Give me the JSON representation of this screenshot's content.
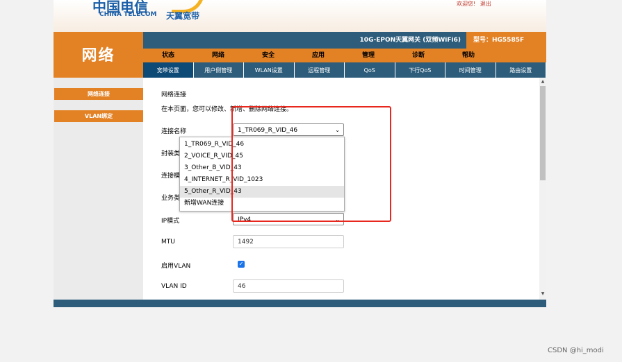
{
  "header": {
    "brand_cn": "中国电信",
    "brand_en": "CHINA TELECOM",
    "sub_brand": "天翼宽带",
    "welcome": "欢迎您!",
    "logout": "退出"
  },
  "section_title": "网络",
  "device": {
    "name": "10G-EPON天翼网关 (双频WiFi6)",
    "model": "型号：HG5585F"
  },
  "main_menu": [
    "状态",
    "网络",
    "安全",
    "应用",
    "管理",
    "诊断",
    "帮助"
  ],
  "sub_menu": [
    "宽带设置",
    "用户侧管理",
    "WLAN设置",
    "远程管理",
    "QoS",
    "下行QoS",
    "时间管理",
    "路由设置"
  ],
  "left_menu": [
    "网络连接",
    "VLAN绑定"
  ],
  "content": {
    "title": "网络连接",
    "description": "在本页面，您可以修改、新增、删除网络连接。",
    "labels": {
      "connection_name": "连接名称",
      "encapsulation": "封装类型",
      "connection_mode": "连接模式",
      "service_type": "业务类型",
      "ip_mode": "IP模式",
      "mtu": "MTU",
      "enable_vlan": "启用VLAN",
      "vlan_id": "VLAN ID"
    },
    "connection_name_value": "1_TR069_R_VID_46",
    "ip_mode_value": "IPv4",
    "mtu_value": "1492",
    "vlan_id_value": "46",
    "enable_vlan_checked": true,
    "dropdown_options": [
      "1_TR069_R_VID_46",
      "2_VOICE_R_VID_45",
      "3_Other_B_VID_43",
      "4_INTERNET_R_VID_1023",
      "5_Other_R_VID_43",
      "新增WAN连接"
    ],
    "highlighted_option": "5_Other_R_VID_43"
  },
  "colors": {
    "orange": "#e38225",
    "navy": "#2d5d7b",
    "highlight_red": "#e8271f"
  },
  "watermark": "CSDN @hi_modi"
}
